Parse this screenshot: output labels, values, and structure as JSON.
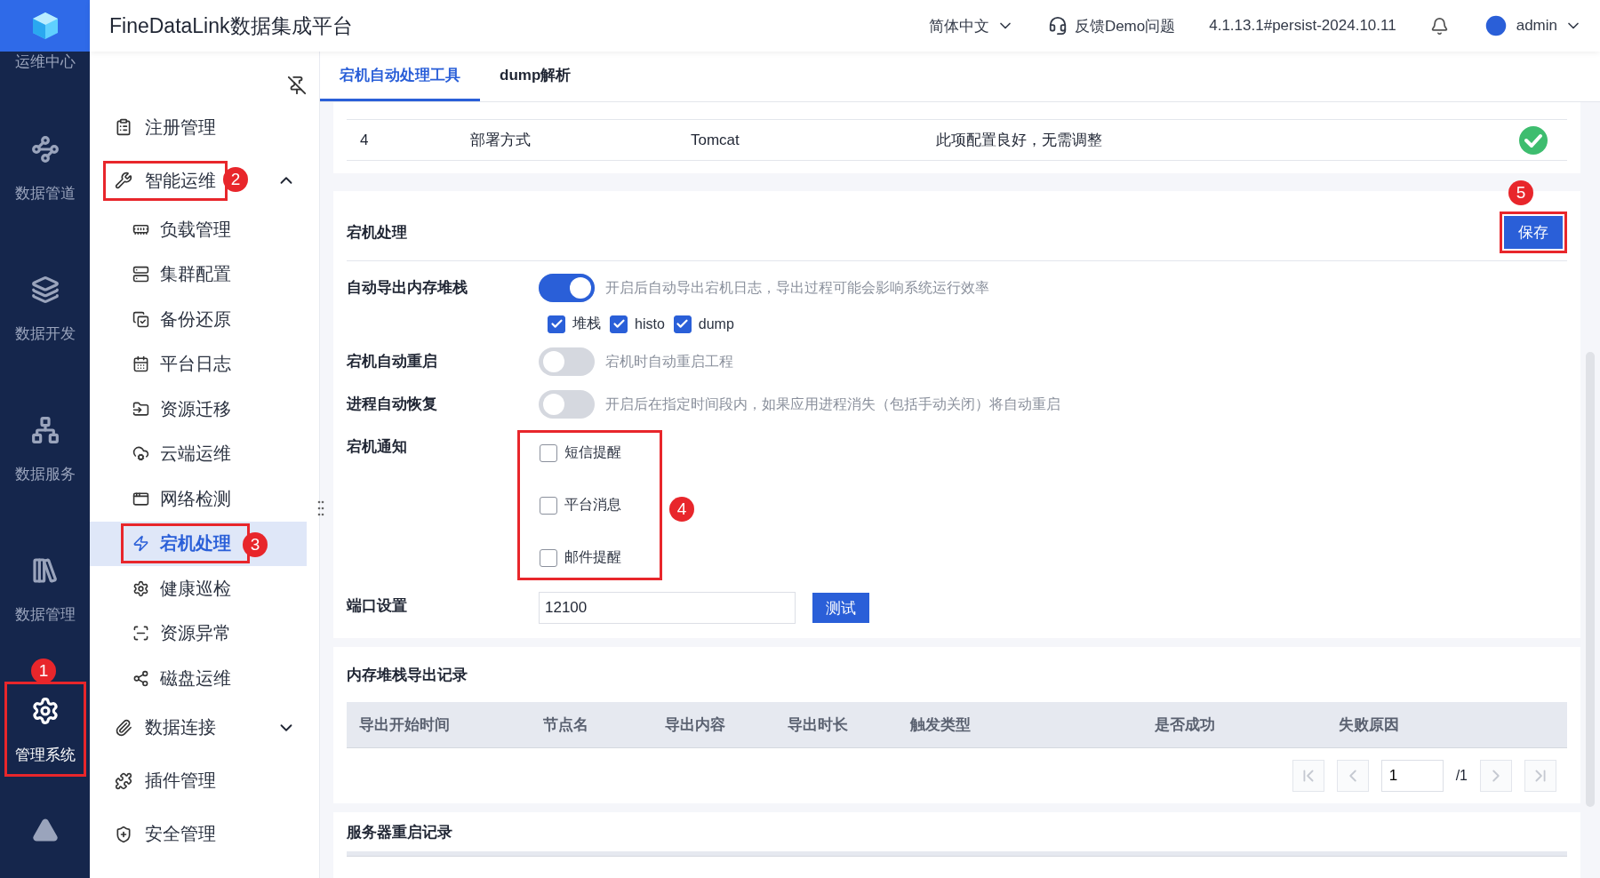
{
  "rail": {
    "items": [
      {
        "label": "运维中心",
        "selected": false
      },
      {
        "label": "数据管道",
        "selected": false
      },
      {
        "label": "数据开发",
        "selected": false
      },
      {
        "label": "数据服务",
        "selected": false
      },
      {
        "label": "数据管理",
        "selected": false
      },
      {
        "label": "管理系统",
        "selected": true,
        "highlight": true,
        "badge": "1"
      }
    ]
  },
  "header": {
    "title": "FineDataLink数据集成平台",
    "language": "简体中文",
    "feedback": "反馈Demo问题",
    "version": "4.1.13.1#persist-2024.10.11",
    "user": "admin"
  },
  "sidebar": {
    "items": [
      {
        "kind": "item",
        "label": "注册管理",
        "highlight": false
      },
      {
        "kind": "group",
        "label": "智能运维",
        "expanded": true,
        "highlight": true,
        "badge": "2",
        "children": [
          {
            "label": "负载管理",
            "selected": false,
            "highlight": false
          },
          {
            "label": "集群配置",
            "selected": false,
            "highlight": false
          },
          {
            "label": "备份还原",
            "selected": false,
            "highlight": false
          },
          {
            "label": "平台日志",
            "selected": false,
            "highlight": false
          },
          {
            "label": "资源迁移",
            "selected": false,
            "highlight": false
          },
          {
            "label": "云端运维",
            "selected": false,
            "highlight": false
          },
          {
            "label": "网络检测",
            "selected": false,
            "highlight": false
          },
          {
            "label": "宕机处理",
            "selected": true,
            "highlight": true,
            "badge": "3"
          },
          {
            "label": "健康巡检",
            "selected": false,
            "highlight": false
          },
          {
            "label": "资源异常",
            "selected": false,
            "highlight": false
          },
          {
            "label": "磁盘运维",
            "selected": false,
            "highlight": false
          }
        ]
      },
      {
        "kind": "group",
        "label": "数据连接",
        "expanded": false,
        "highlight": false
      },
      {
        "kind": "item",
        "label": "插件管理",
        "highlight": false
      },
      {
        "kind": "item",
        "label": "安全管理",
        "highlight": false
      }
    ]
  },
  "tabs": [
    {
      "label": "宕机自动处理工具",
      "selected": true
    },
    {
      "label": "dump解析",
      "selected": false
    }
  ],
  "config_table": {
    "rows": [
      {
        "cells": [
          "4",
          "部署方式",
          "Tomcat",
          "此项配置良好，无需调整"
        ],
        "ok": true
      }
    ]
  },
  "crash_handling": {
    "title": "宕机处理",
    "save": {
      "label": "保存",
      "badge": "5",
      "highlight": true
    },
    "settings": [
      {
        "kind": "toggle",
        "label": "自动导出内存堆栈",
        "on": true,
        "hint": "开启后自动导出宕机日志，导出过程可能会影响系统运行效率",
        "options": [
          {
            "label": "堆栈",
            "checked": true
          },
          {
            "label": "histo",
            "checked": true
          },
          {
            "label": "dump",
            "checked": true
          }
        ]
      },
      {
        "kind": "toggle",
        "label": "宕机自动重启",
        "on": false,
        "hint": "宕机时自动重启工程"
      },
      {
        "kind": "toggle",
        "label": "进程自动恢复",
        "on": false,
        "hint": "开启后在指定时间段内，如果应用进程消失（包括手动关闭）将自动重启"
      },
      {
        "kind": "checklist",
        "label": "宕机通知",
        "highlight": true,
        "badge": "4",
        "options": [
          {
            "label": "短信提醒",
            "checked": false
          },
          {
            "label": "平台消息",
            "checked": false
          },
          {
            "label": "邮件提醒",
            "checked": false
          }
        ]
      },
      {
        "kind": "port",
        "label": "端口设置",
        "value": "12100",
        "button": "测试"
      }
    ]
  },
  "export_records": {
    "title": "内存堆栈导出记录",
    "columns": [
      "导出开始时间",
      "节点名",
      "导出内容",
      "导出时长",
      "触发类型",
      "是否成功",
      "失败原因"
    ],
    "pagination": {
      "page": "1",
      "total": "/1"
    }
  },
  "restart_records": {
    "title": "服务器重启记录"
  }
}
